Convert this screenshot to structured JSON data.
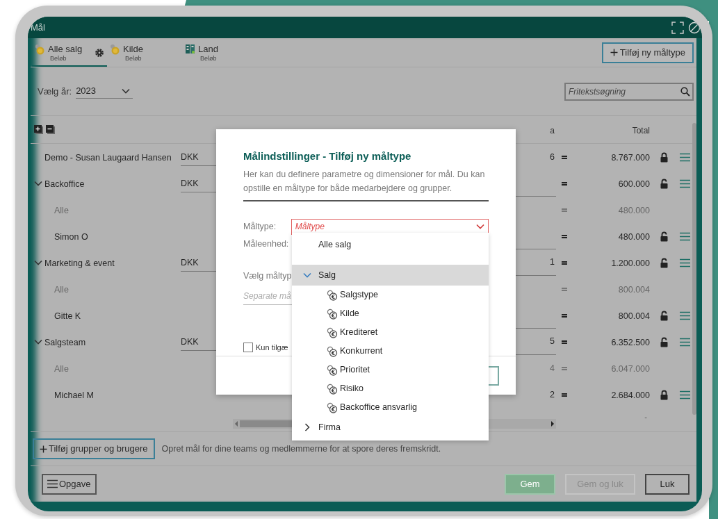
{
  "window": {
    "title": "Mål"
  },
  "tabs": [
    {
      "label": "Alle salg",
      "sublabel": "Beløb",
      "kind": "coins",
      "selected": true,
      "settings": true
    },
    {
      "label": "Kilde",
      "sublabel": "Beløb",
      "kind": "coins",
      "selected": false,
      "settings": false
    },
    {
      "label": "Land",
      "sublabel": "Beløb",
      "kind": "building",
      "selected": false,
      "settings": false
    }
  ],
  "add_type_button": {
    "label": "Tilføj ny måltype"
  },
  "year": {
    "label": "Vælg år:",
    "value": "2023"
  },
  "search": {
    "placeholder": "Fritekstsøgning"
  },
  "table": {
    "columns": [
      {
        "label": "a"
      },
      {
        "label": "Total"
      }
    ],
    "rows": [
      {
        "name": "Demo - Susan Laugaard Hansen",
        "currency": "DKK",
        "column_a": "6",
        "total": "8.767.000",
        "locked": true
      },
      {
        "name": "Backoffice",
        "currency": "DKK",
        "total": "600.000",
        "locked": false,
        "expanded": true,
        "children": [
          {
            "name": "Alle",
            "total": "480.000",
            "kind": "summary"
          },
          {
            "name": "Simon O",
            "total": "480.000",
            "locked": false
          }
        ]
      },
      {
        "name": "Marketing & event",
        "currency": "DKK",
        "column_a": "1",
        "total": "1.200.000",
        "locked": false,
        "expanded": true,
        "children": [
          {
            "name": "Alle",
            "total": "800.004",
            "kind": "summary"
          },
          {
            "name": "Gitte K",
            "total": "800.004",
            "locked": false
          }
        ]
      },
      {
        "name": "Salgsteam",
        "currency": "DKK",
        "column_a": "5",
        "total": "6.352.500",
        "locked": false,
        "expanded": true,
        "children": [
          {
            "name": "Alle",
            "column_a": "4",
            "total": "6.047.000",
            "kind": "summary"
          },
          {
            "name": "Michael M",
            "column_a": "2",
            "total": "2.684.000",
            "locked": true
          }
        ]
      }
    ],
    "footer_total": "-"
  },
  "add_groups_button": {
    "label": "Tilføj grupper og brugere"
  },
  "hint": "Opret mål for dine teams og medlemmerne for at spore deres fremskridt.",
  "task_button": {
    "label": "Opgave"
  },
  "buttons": [
    {
      "label": "Gem",
      "kind": "primary",
      "disabled": true
    },
    {
      "label": "Gem og luk",
      "kind": "secondary",
      "disabled": true
    },
    {
      "label": "Luk",
      "kind": "secondary",
      "disabled": false
    }
  ],
  "dialog": {
    "title": "Målindstillinger - Tilføj ny måltype",
    "description": "Her kan du definere parametre og dimensioner for mål. Du kan opstille en måltype for både medarbejdere og grupper.",
    "type_label": "Måltype:",
    "type_placeholder": "Måltype",
    "unit_label": "Måleenhed:",
    "choose_label": "Vælg måltyp",
    "separate_placeholder": "Separate må",
    "checkbox": {
      "label": "Kun tilgæ",
      "checked": false
    }
  },
  "dropdown": {
    "items": [
      {
        "label": "Alle salg",
        "highlighted": false
      },
      {
        "label": "Salg",
        "highlighted": true,
        "expanded": true,
        "children": [
          {
            "label": "Salgstype"
          },
          {
            "label": "Kilde"
          },
          {
            "label": "Krediteret"
          },
          {
            "label": "Konkurrent"
          },
          {
            "label": "Prioritet"
          },
          {
            "label": "Risiko"
          },
          {
            "label": "Backoffice ansvarlig"
          }
        ]
      },
      {
        "label": "Firma",
        "highlighted": false,
        "expanded": false
      }
    ]
  }
}
